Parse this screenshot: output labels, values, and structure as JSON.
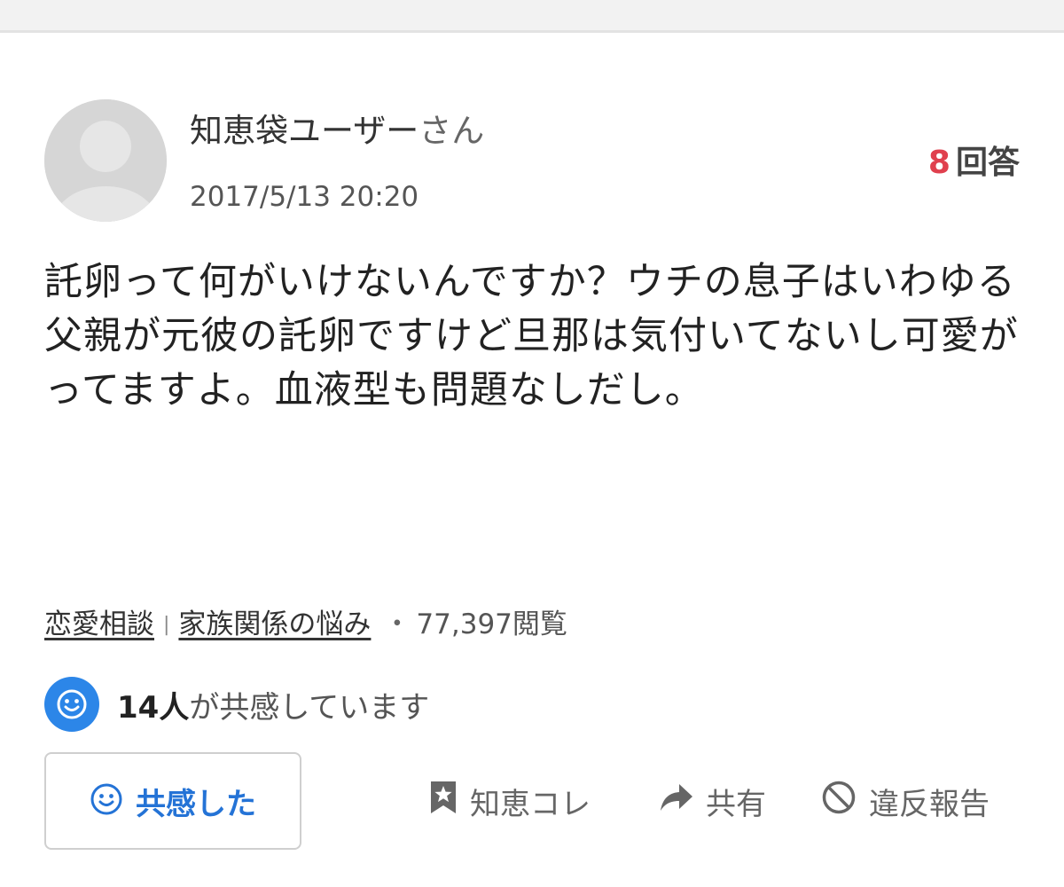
{
  "question": {
    "author_name": "知恵袋ユーザー",
    "author_suffix": "さん",
    "date": "2017/5/13 20:20",
    "answer_count": "8",
    "answer_label": "回答",
    "body": "託卵って何がいけないんですか？ウチの息子はいわゆる父親が元彼の託卵ですけど旦那は気付いてないし可愛がってますよ。血液型も問題なしだし。",
    "category_primary": "恋愛相談",
    "category_separator": "|",
    "category_secondary": "家族関係の悩み",
    "views_dot": "・",
    "views": "77,397閲覧"
  },
  "empathy": {
    "count": "14人",
    "text": "が共感しています",
    "icon": "smiley-icon"
  },
  "actions": {
    "empathize_label": "共感した",
    "collect_label": "知恵コレ",
    "share_label": "共有",
    "report_label": "違反報告"
  },
  "colors": {
    "accent_blue": "#2c86e8",
    "answer_count_red": "#e0404e",
    "text_dark": "#222222",
    "text_gray": "#666666"
  }
}
